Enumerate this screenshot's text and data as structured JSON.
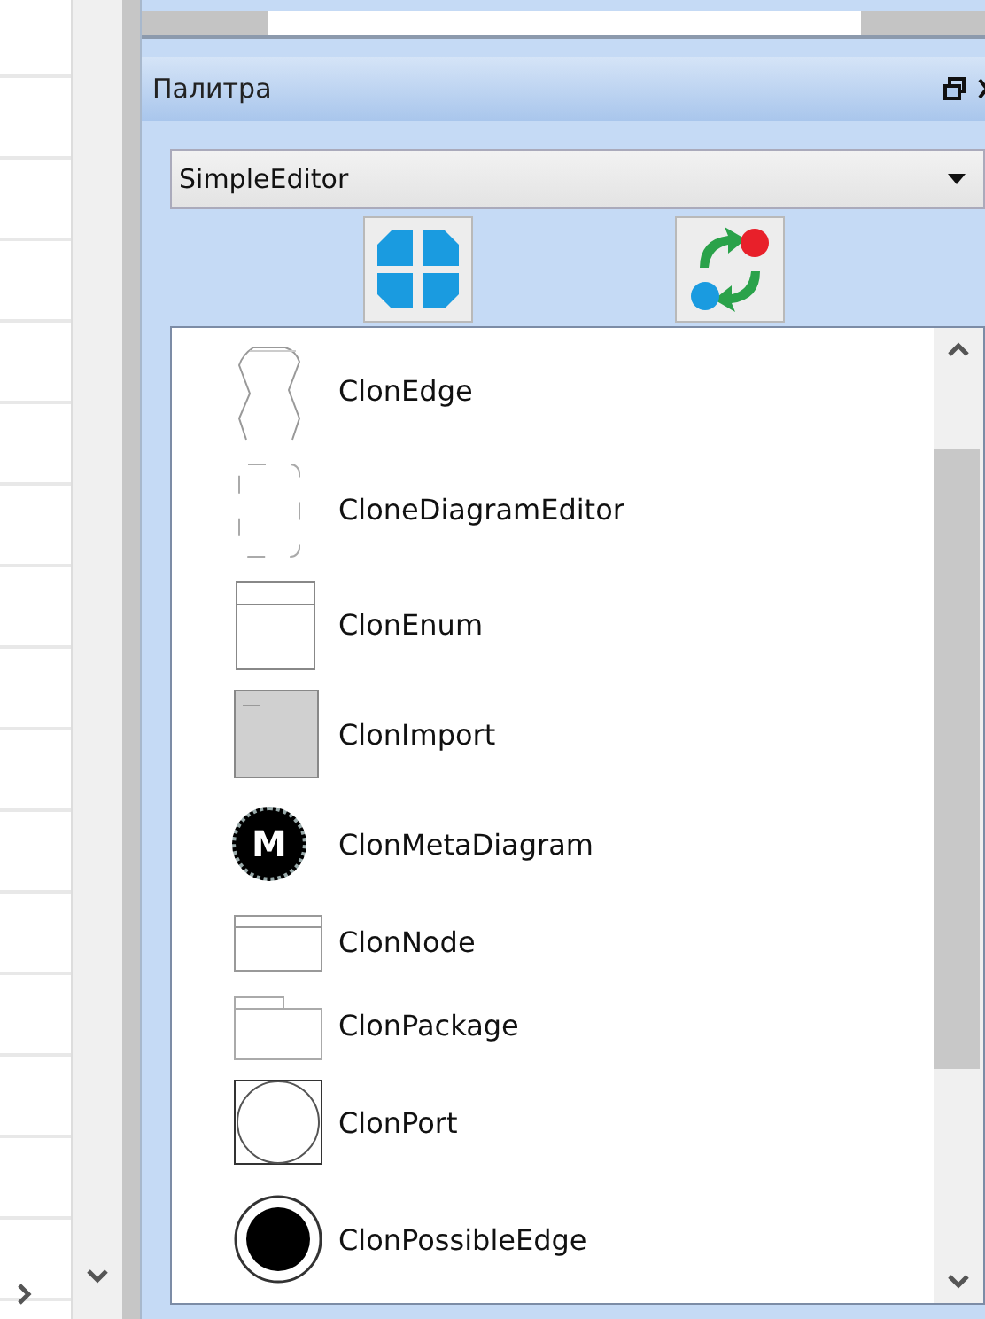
{
  "palette": {
    "title": "Палитра",
    "editor_select": {
      "value": "SimpleEditor"
    },
    "toolbar": [
      {
        "kind": "collapse"
      },
      {
        "kind": "sync"
      }
    ],
    "items": [
      {
        "kind": "edge",
        "label": "ClonEdge"
      },
      {
        "kind": "editor",
        "label": "CloneDiagramEditor"
      },
      {
        "kind": "enum",
        "label": "ClonEnum"
      },
      {
        "kind": "import",
        "label": "ClonImport"
      },
      {
        "kind": "meta",
        "label": "ClonMetaDiagram",
        "icon_letter": "M"
      },
      {
        "kind": "node",
        "label": "ClonNode"
      },
      {
        "kind": "package",
        "label": "ClonPackage"
      },
      {
        "kind": "port",
        "label": "ClonPort"
      },
      {
        "kind": "possible_edge",
        "label": "ClonPossibleEdge"
      }
    ]
  }
}
